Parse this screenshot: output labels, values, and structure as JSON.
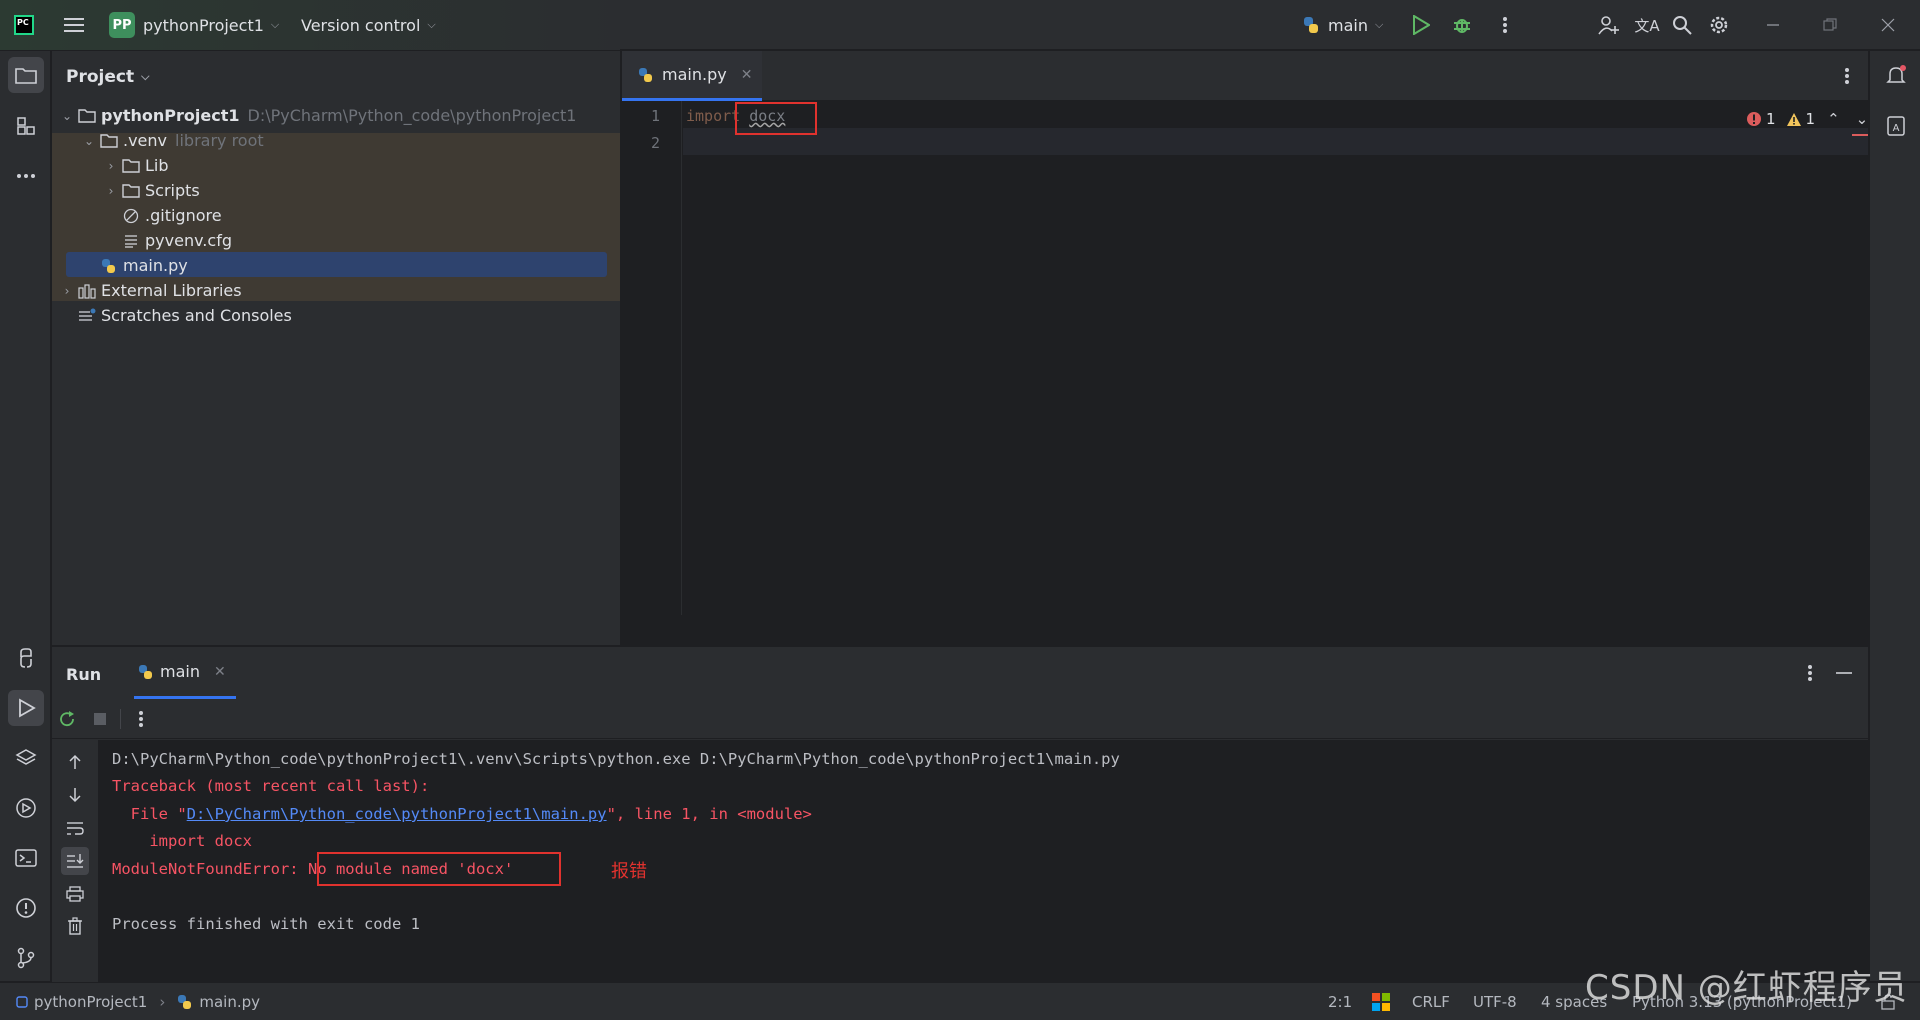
{
  "titlebar": {
    "app_logo": "PC",
    "project_badge": "PP",
    "project_name": "pythonProject1",
    "version_control": "Version control",
    "run_config": "main"
  },
  "project_pane": {
    "header": "Project",
    "root_name": "pythonProject1",
    "root_path": "D:\\PyCharm\\Python_code\\pythonProject1",
    "venv_name": ".venv",
    "venv_hint": "library root",
    "items": {
      "lib": "Lib",
      "scripts": "Scripts",
      "gitignore": ".gitignore",
      "pyvenv": "pyvenv.cfg",
      "main": "main.py",
      "external": "External Libraries",
      "scratches": "Scratches and Consoles"
    }
  },
  "editor": {
    "tab_label": "main.py",
    "line_numbers": [
      "1",
      "2"
    ],
    "code_keyword": "import",
    "code_module": "docx",
    "error_count": "1",
    "warning_count": "1"
  },
  "run_panel": {
    "title": "Run",
    "tab_label": "main",
    "cmd_line": "D:\\PyCharm\\Python_code\\pythonProject1\\.venv\\Scripts\\python.exe D:\\PyCharm\\Python_code\\pythonProject1\\main.py",
    "traceback": "Traceback (most recent call last):",
    "file_prefix": "  File \"",
    "file_link": "D:\\PyCharm\\Python_code\\pythonProject1\\main.py",
    "file_suffix": "\", line 1, in <module>",
    "import_line": "    import docx",
    "error_type": "ModuleNotFoundError:",
    "error_msg": "No module named 'docx'",
    "annotation": "报错",
    "exit_line": "Process finished with exit code 1"
  },
  "statusbar": {
    "breadcrumb_project": "pythonProject1",
    "breadcrumb_file": "main.py",
    "caret": "2:1",
    "line_sep": "CRLF",
    "encoding": "UTF-8",
    "indent": "4 spaces",
    "interpreter": "Python 3.13 (pythonProject1)"
  },
  "watermark": "CSDN @红虾程序员",
  "icons": [
    "pycharm-logo",
    "hamburger-menu-icon",
    "python-icon",
    "run-icon",
    "debug-icon",
    "more-vertical-icon",
    "add-user-icon",
    "translate-icon",
    "search-icon",
    "settings-icon",
    "minimize-icon",
    "restore-icon",
    "close-icon",
    "folder-icon",
    "structure-icon",
    "more-horizontal-icon",
    "python-console-icon",
    "run-tool-icon",
    "layers-icon",
    "services-icon",
    "terminal-icon",
    "problems-icon",
    "git-icon",
    "notifications-icon",
    "ai-assistant-icon",
    "rerun-icon",
    "stop-icon",
    "scroll-up-icon",
    "scroll-down-icon",
    "soft-wrap-icon",
    "scroll-to-end-icon",
    "print-icon",
    "trash-icon",
    "windows-logo-icon"
  ],
  "colors": {
    "accent": "#3574f0",
    "error": "#f75464",
    "annotation_red": "#e0322e",
    "venv_highlight": "#3f3a33",
    "selection": "#2e436e"
  }
}
